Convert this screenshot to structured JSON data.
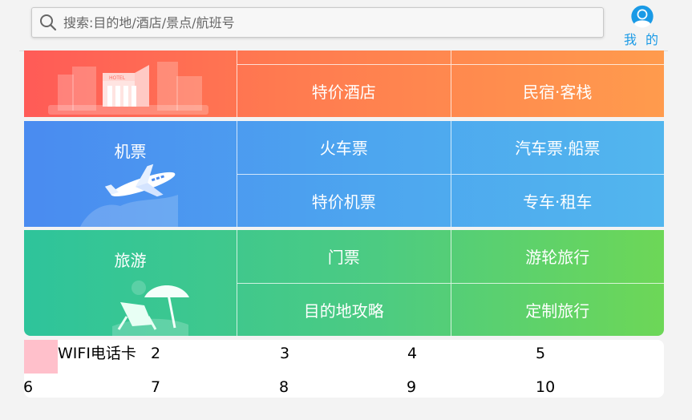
{
  "search": {
    "placeholder": "搜索:目的地/酒店/景点/航班号"
  },
  "header": {
    "me_label": "我 的"
  },
  "hotel_row": {
    "sub_top": [
      "",
      ""
    ],
    "sub_bottom": [
      "特价酒店",
      "民宿·客栈"
    ]
  },
  "flight_row": {
    "main_label": "机票",
    "col1": [
      "火车票",
      "特价机票"
    ],
    "col2": [
      "汽车票·船票",
      "专车·租车"
    ]
  },
  "travel_row": {
    "main_label": "旅游",
    "col1": [
      "门票",
      "目的地攻略"
    ],
    "col2": [
      "游轮旅行",
      "定制旅行"
    ]
  },
  "bottom_items": [
    "WIFI电话卡",
    "2",
    "3",
    "4",
    "5",
    "6",
    "7",
    "8",
    "9",
    "10"
  ],
  "colors": {
    "hotel_gradient": [
      "#ff5b57",
      "#ff9b4d"
    ],
    "flight_gradient": [
      "#4a8bf0",
      "#52b6ee"
    ],
    "travel_gradient": [
      "#2ec49b",
      "#6dd757"
    ],
    "me_accent": "#1a9ae6",
    "placeholder_tile": "#ffc0cb"
  },
  "icons": {
    "search": "search-icon",
    "user": "user-avatar-icon",
    "hotel": "hotel-building-icon",
    "plane": "airplane-icon",
    "beach": "beach-chair-icon"
  }
}
